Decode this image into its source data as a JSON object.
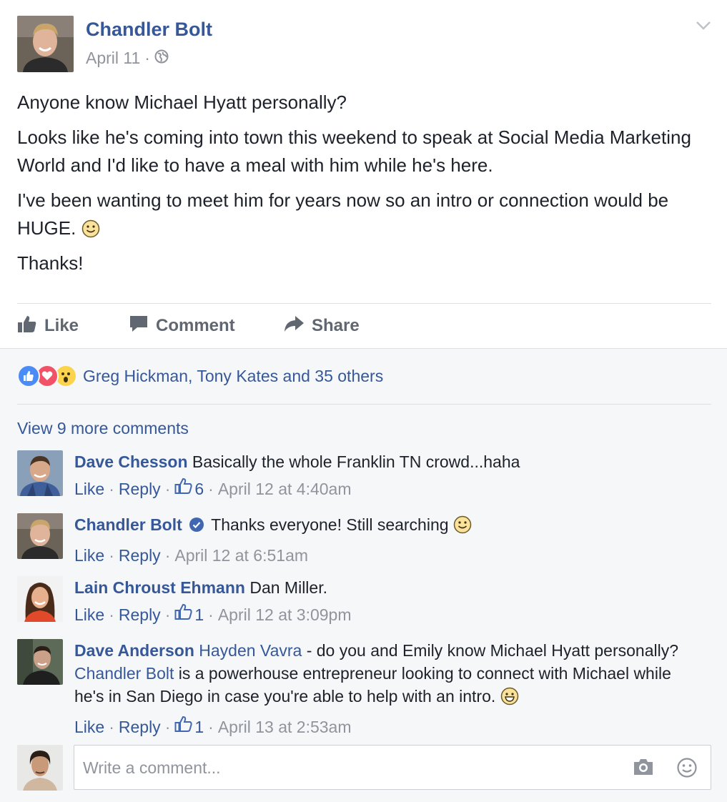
{
  "post": {
    "author": "Chandler Bolt",
    "date": "April 11",
    "paragraphs": [
      "Anyone know Michael Hyatt personally?",
      "Looks like he's coming into town this weekend to speak at Social Media Marketing World and I'd like to have a meal with him while he's here.",
      "I've been wanting to meet him for years now so an intro or connection would be HUGE.",
      "Thanks!"
    ]
  },
  "actions": {
    "like": "Like",
    "comment": "Comment",
    "share": "Share"
  },
  "reactions": {
    "names": "Greg Hickman, Tony Kates and 35 others"
  },
  "view_more": "View 9 more comments",
  "comments": [
    {
      "author": "Dave Chesson",
      "text": "Basically the whole Franklin TN crowd...haha",
      "like": "Like",
      "reply": "Reply",
      "likes": "6",
      "time": "April 12 at 4:40am"
    },
    {
      "author": "Chandler Bolt",
      "text": "Thanks everyone! Still searching",
      "like": "Like",
      "reply": "Reply",
      "time": "April 12 at 6:51am"
    },
    {
      "author": "Lain Chroust Ehmann",
      "text": "Dan Miller.",
      "like": "Like",
      "reply": "Reply",
      "likes": "1",
      "time": "April 12 at 3:09pm"
    },
    {
      "author": "Dave Anderson",
      "mention1": "Hayden Vavra",
      "text1": "- do you and Emily know Michael Hyatt personally?",
      "mention2": "Chandler Bolt",
      "text2": "is a powerhouse entrepreneur looking to connect with Michael while he's in San Diego in case you're able to help with an intro.",
      "like": "Like",
      "reply": "Reply",
      "likes": "1",
      "time": "April 13 at 2:53am"
    }
  ],
  "write_comment": {
    "placeholder": "Write a comment..."
  }
}
